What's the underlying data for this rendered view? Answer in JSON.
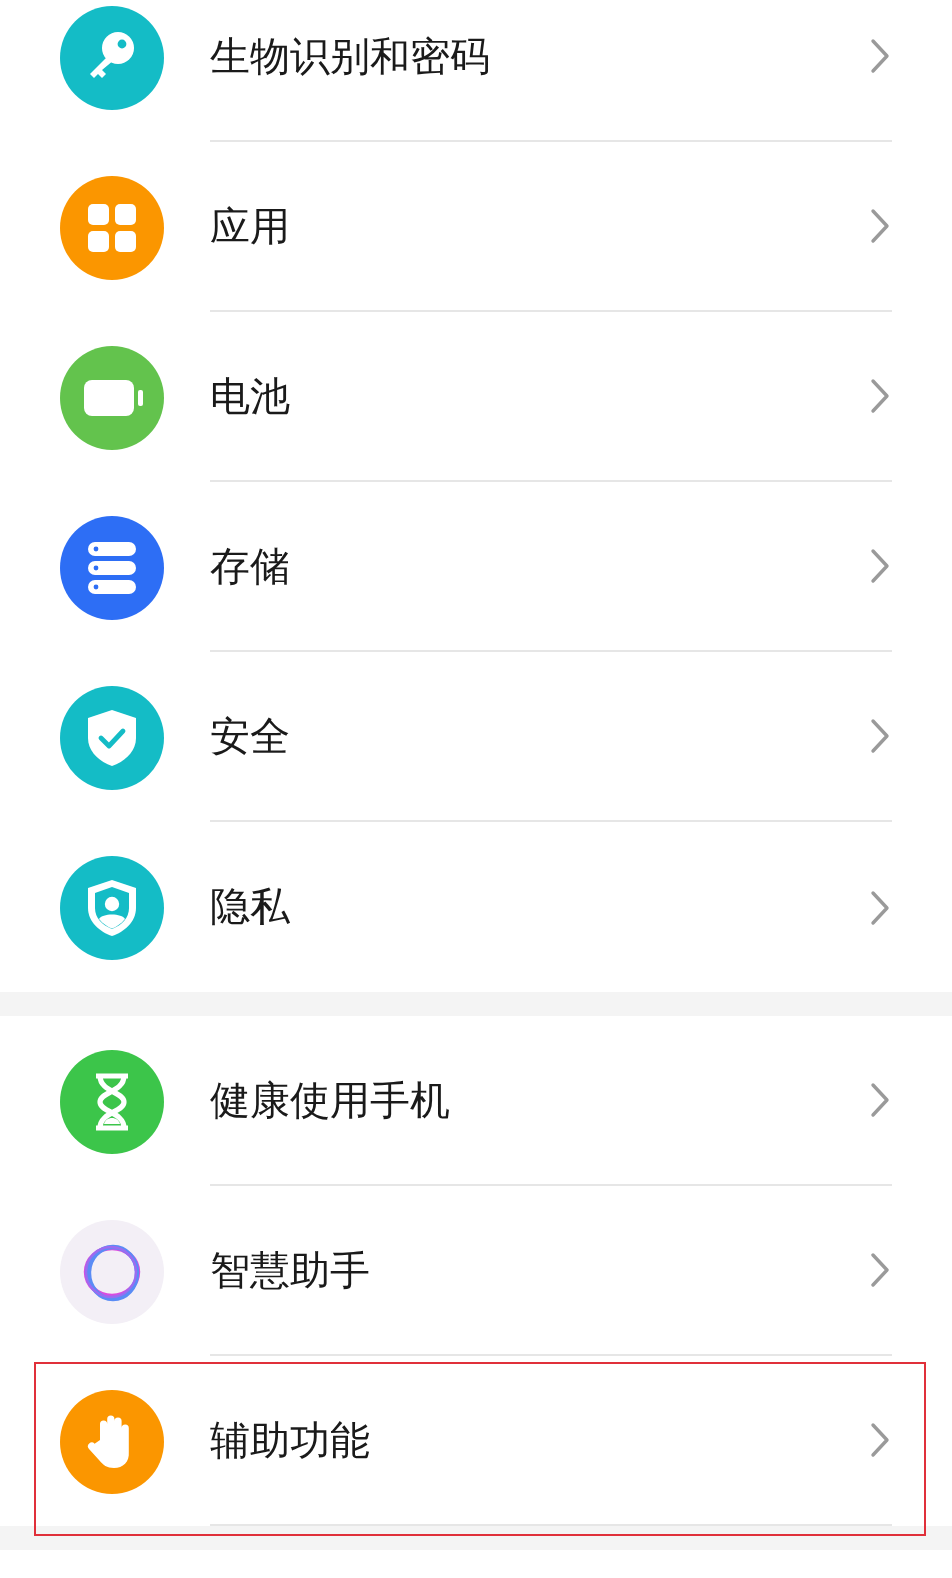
{
  "groups": [
    {
      "items": [
        {
          "label": "生物识别和密码",
          "kind": "key",
          "color": "#14bcc6",
          "highlighted": false
        },
        {
          "label": "应用",
          "kind": "apps",
          "color": "#fb9600",
          "highlighted": false
        },
        {
          "label": "电池",
          "kind": "battery",
          "color": "#63c34d",
          "highlighted": false
        },
        {
          "label": "存储",
          "kind": "storage",
          "color": "#2d6ef5",
          "highlighted": false
        },
        {
          "label": "安全",
          "kind": "shield-check",
          "color": "#14bcc6",
          "highlighted": false
        },
        {
          "label": "隐私",
          "kind": "shield-person",
          "color": "#14bcc6",
          "highlighted": false
        }
      ]
    },
    {
      "items": [
        {
          "label": "健康使用手机",
          "kind": "hourglass",
          "color": "#3cc54a",
          "highlighted": false
        },
        {
          "label": "智慧助手",
          "kind": "ring",
          "color": "#f3eff6",
          "highlighted": false
        },
        {
          "label": "辅助功能",
          "kind": "hand",
          "color": "#fb9600",
          "highlighted": true
        }
      ]
    }
  ]
}
